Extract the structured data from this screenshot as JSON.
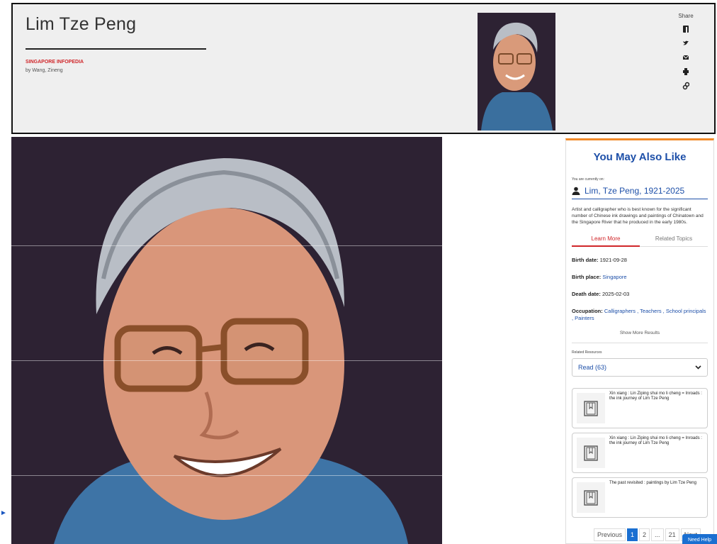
{
  "header": {
    "title": "Lim Tze Peng",
    "category": "Singapore Infopedia",
    "byline": "by Wang, Zineng",
    "share_label": "Share",
    "share_icons": [
      "facebook-icon",
      "twitter-icon",
      "email-icon",
      "print-icon",
      "link-icon"
    ]
  },
  "panel": {
    "title": "You May Also Like",
    "currently_label": "You are currently on:",
    "current_item": "Lim, Tze Peng, 1921-2025",
    "description": "Artist and calligrapher who is best known for the significant number of Chinese ink drawings and paintings of Chinatown and the Singapore River that he produced in the early 1980s.",
    "tabs": [
      "Learn More",
      "Related Topics"
    ],
    "birth_date_label": "Birth date:",
    "birth_date": "1921-09-28",
    "birth_place_label": "Birth place:",
    "birth_place": "Singapore",
    "death_date_label": "Death date:",
    "death_date": "2025-02-03",
    "occupation_label": "Occupation:",
    "occupation": "Calligraphers , Teachers , School principals , Painters",
    "show_more": "Show More Results",
    "related_label": "Related Resources",
    "select_value": "Read (63)",
    "books": [
      "Xin xiang : Lin Ziping shui mo li cheng = Inroads : the ink journey of Lim Tze Peng",
      "Xin xiang : Lin Ziping shui mo li cheng = Inroads : the ink journey of Lim Tze Peng",
      "The past revisited : paintings by Lim Tze Peng"
    ]
  },
  "pagination": {
    "previous": "Previous",
    "pages": [
      "1",
      "2",
      "...",
      "21"
    ],
    "next": "Next",
    "current": "1"
  },
  "help_button": "Need Help",
  "colors": {
    "accent_blue": "#1d4fa8",
    "accent_red": "#d0262a",
    "panel_top": "#f18a2a",
    "photo_bg": "#2d2233"
  }
}
